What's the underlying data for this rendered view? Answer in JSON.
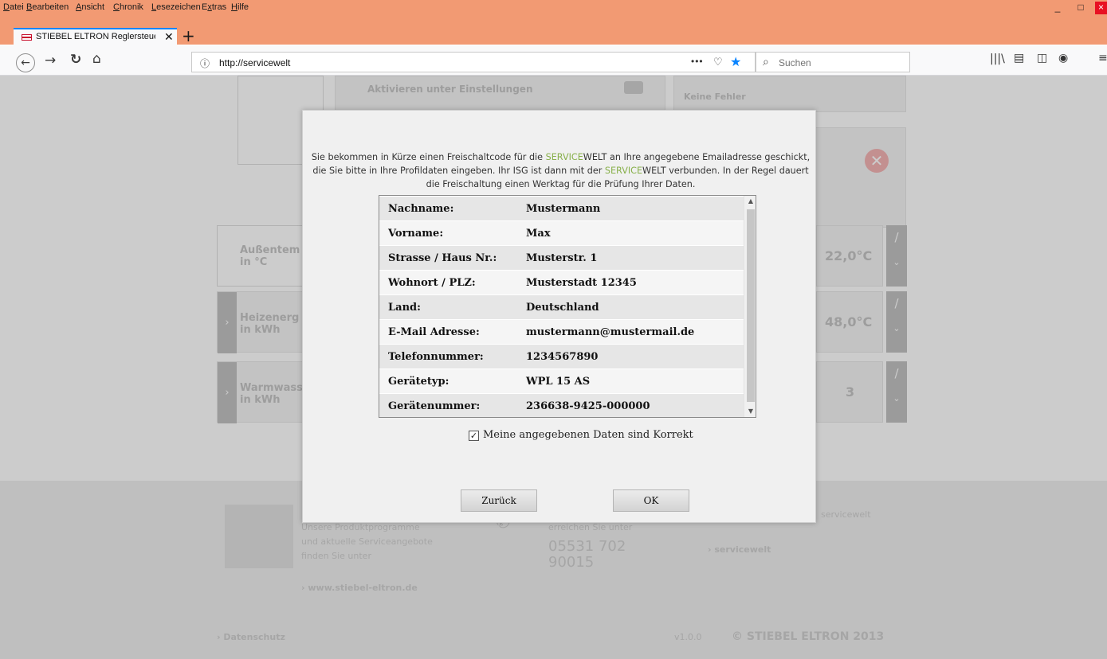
{
  "menu": [
    "Datei",
    "Bearbeiten",
    "Ansicht",
    "Chronik",
    "Lesezeichen",
    "Extras",
    "Hilfe"
  ],
  "tab": {
    "title": "STIEBEL ELTRON Reglersteueru"
  },
  "window_controls": {
    "minimize": "_",
    "maximize": "□",
    "close": "×"
  },
  "navbar": {
    "url": "http://servicewelt",
    "search_placeholder": "Suchen",
    "page_actions": "•••"
  },
  "page": {
    "activate_hint": "Aktivieren unter Einstellungen",
    "status_text": "Keine Fehler",
    "rows": [
      {
        "label": "Außentem",
        "unit": "in °C",
        "value": "22,0°C"
      },
      {
        "label": "Heizenerg",
        "unit": "in kWh",
        "value": "48,0°C"
      },
      {
        "label": "Warmwass",
        "unit": "in kWh",
        "value": "3"
      }
    ],
    "footer": {
      "text_1": "Unsere Produktprogramme",
      "text_2": "und aktuelle Serviceangebote",
      "text_3": "finden Sie unter",
      "link_1": "www.stiebel-eltron.de",
      "hotline_text": "erreichen Sie unter",
      "phone": "05531 702",
      "phone_2": "90015",
      "servicewelt_title": "servicewelt",
      "servicewelt_link": "servicewelt",
      "datenschutz": "Datenschutz",
      "version": "v1.0.0",
      "copyright": "© STIEBEL ELTRON 2013"
    }
  },
  "dialog": {
    "message_part1": "Sie bekommen in Kürze einen Freischaltcode für die ",
    "service_brand_a": "SERVICE",
    "service_brand_b": "WELT",
    "message_part2": " an Ihre angegebene Emailadresse geschickt, die Sie bitte in Ihre Profildaten eingeben. Ihr ISG ist dann mit der ",
    "message_part3": " verbunden. In der Regel dauert die Freischaltung einen Werktag für die Prüfung Ihrer Daten.",
    "rows": [
      {
        "label": "Nachname:",
        "value": "Mustermann"
      },
      {
        "label": "Vorname:",
        "value": "Max"
      },
      {
        "label": "Strasse / Haus Nr.:",
        "value": "Musterstr.   1"
      },
      {
        "label": "Wohnort / PLZ:",
        "value": "Musterstadt   12345"
      },
      {
        "label": "Land:",
        "value": "Deutschland"
      },
      {
        "label": "E-Mail Adresse:",
        "value": "mustermann@mustermail.de"
      },
      {
        "label": "Telefonnummer:",
        "value": "1234567890"
      },
      {
        "label": "Gerätetyp:",
        "value": "WPL 15 AS"
      },
      {
        "label": "Gerätenummer:",
        "value": "236638-9425-000000"
      }
    ],
    "checkbox_label": "Meine angegebenen Daten sind Korrekt",
    "checkbox_checked": true,
    "back_button": "Zurück",
    "ok_button": "OK"
  }
}
